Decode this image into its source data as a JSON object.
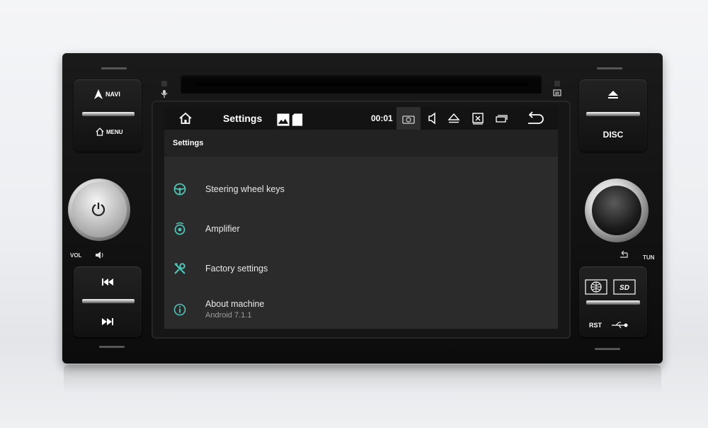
{
  "device": {
    "left_panel": {
      "navi_label": "NAVI",
      "menu_label": "MENU",
      "vol_label": "VOL"
    },
    "right_panel": {
      "disc_label": "DISC",
      "tun_label": "TUN",
      "rst_label": "RST"
    }
  },
  "status_bar": {
    "title": "Settings",
    "clock": "00:01",
    "icons": [
      "home-icon",
      "image-icon",
      "sd-card-icon",
      "screenshot-icon",
      "volume-icon",
      "eject-icon",
      "close-window-icon",
      "recent-apps-icon",
      "back-icon"
    ]
  },
  "header": {
    "title": "Settings"
  },
  "settings_list": [
    {
      "label": "Steering wheel keys",
      "sublabel": "",
      "icon": "steering-wheel-icon"
    },
    {
      "label": "Amplifier",
      "sublabel": "",
      "icon": "speaker-icon"
    },
    {
      "label": "Factory settings",
      "sublabel": "",
      "icon": "tools-icon"
    },
    {
      "label": "About machine",
      "sublabel": "Android 7.1.1",
      "icon": "info-icon"
    }
  ],
  "colors": {
    "accent_teal": "#4fc3b5",
    "screen_background": "#2b2b2b",
    "status_bar": "#131313"
  }
}
